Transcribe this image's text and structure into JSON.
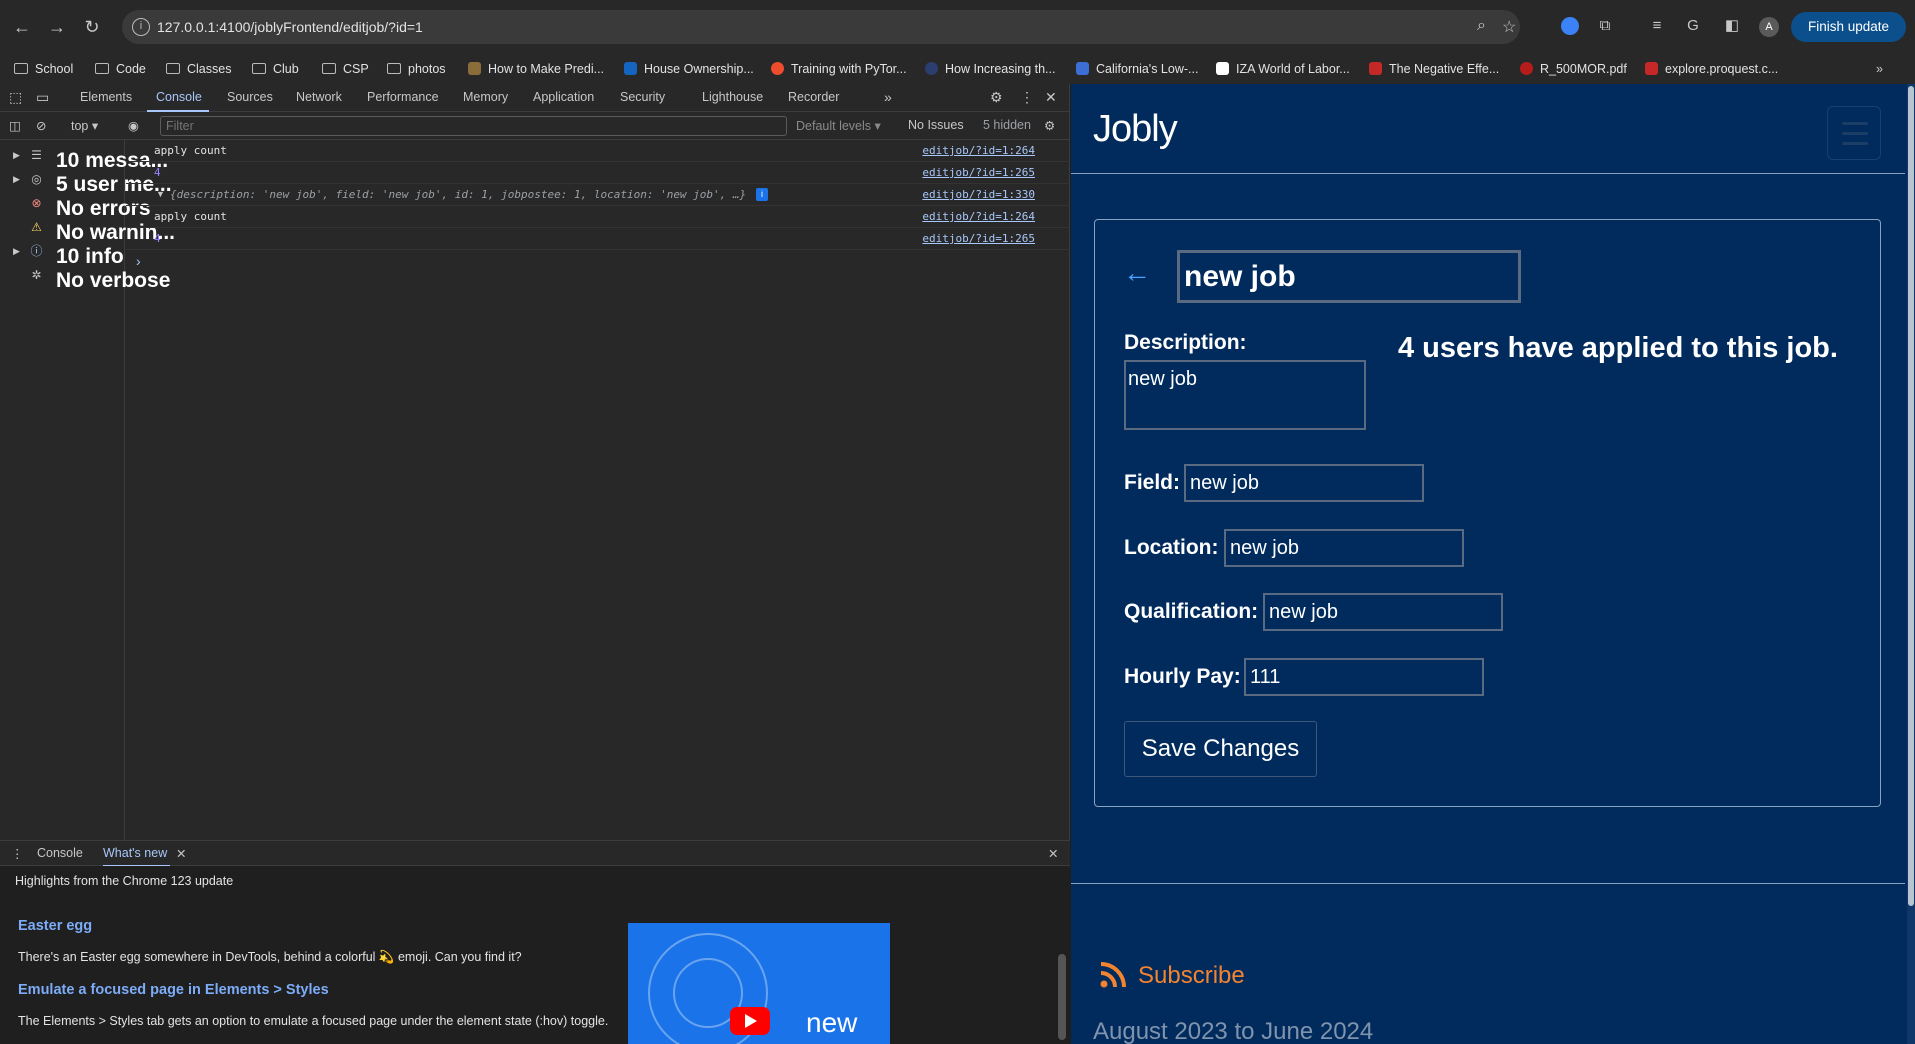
{
  "browser": {
    "url": "127.0.0.1:4100/joblyFrontend/editjob/?id=1",
    "avatar_letter": "A",
    "finish_update": "Finish update",
    "bookmarks": [
      {
        "label": "School",
        "type": "folder"
      },
      {
        "label": "Code",
        "type": "folder"
      },
      {
        "label": "Classes",
        "type": "folder"
      },
      {
        "label": "Club",
        "type": "folder"
      },
      {
        "label": "CSP",
        "type": "folder"
      },
      {
        "label": "photos",
        "type": "folder"
      },
      {
        "label": "How to Make Predi...",
        "type": "page"
      },
      {
        "label": "House Ownership...",
        "type": "page"
      },
      {
        "label": "Training with PyTor...",
        "type": "page"
      },
      {
        "label": "How Increasing th...",
        "type": "page"
      },
      {
        "label": "California's Low-...",
        "type": "page"
      },
      {
        "label": "IZA World of Labor...",
        "type": "page"
      },
      {
        "label": "The Negative Effe...",
        "type": "page"
      },
      {
        "label": "R_500MOR.pdf",
        "type": "page"
      },
      {
        "label": "explore.proquest.c...",
        "type": "page"
      }
    ]
  },
  "devtools": {
    "tabs": [
      "Elements",
      "Console",
      "Sources",
      "Network",
      "Performance",
      "Memory",
      "Application",
      "Security",
      "Lighthouse",
      "Recorder"
    ],
    "active_tab": "Console",
    "context": "top",
    "filter_placeholder": "Filter",
    "default_levels": "Default levels",
    "issues": "No Issues",
    "hidden": "5 hidden",
    "sidebar": [
      {
        "label": "10 messa...",
        "icon": "list-icon",
        "expandable": true
      },
      {
        "label": "5 user me...",
        "icon": "user-icon",
        "expandable": true
      },
      {
        "label": "No errors",
        "icon": "error-icon",
        "expandable": false
      },
      {
        "label": "No warnin...",
        "icon": "warning-icon",
        "expandable": false
      },
      {
        "label": "10 info",
        "icon": "info-icon",
        "expandable": true
      },
      {
        "label": "No verbose",
        "icon": "bug-icon",
        "expandable": false
      }
    ],
    "logs": [
      {
        "text": "apply count",
        "source": "editjob/?id=1:264"
      },
      {
        "text": "4",
        "source": "editjob/?id=1:265"
      },
      {
        "text": "{description: 'new job', field: 'new job', id: 1, jobpostee: 1, location: 'new job', …}",
        "source": "editjob/?id=1:330"
      },
      {
        "text": "apply count",
        "source": "editjob/?id=1:264"
      },
      {
        "text": "4",
        "source": "editjob/?id=1:265"
      }
    ],
    "drawer": {
      "tabs": [
        "Console",
        "What's new"
      ],
      "highlights": "Highlights from the Chrome 123 update",
      "items": [
        {
          "title": "Easter egg",
          "body": "There's an Easter egg somewhere in DevTools, behind a colorful 💫 emoji. Can you find it?"
        },
        {
          "title": "Emulate a focused page in Elements > Styles",
          "body": "The Elements > Styles tab gets an option to emulate a focused page under the element state (:hov) toggle."
        }
      ],
      "video_text": "new"
    }
  },
  "page": {
    "brand": "Jobly",
    "job_title": "new job",
    "description_label": "Description:",
    "description_value": "new job",
    "applied_text": "4 users have applied to this job.",
    "field_label": "Field:",
    "field_value": "new job",
    "location_label": "Location:",
    "location_value": "new job",
    "qualification_label": "Qualification:",
    "qualification_value": "new job",
    "pay_label": "Hourly Pay:",
    "pay_value": "111",
    "save_label": "Save Changes",
    "subscribe_label": "Subscribe",
    "dates": "August 2023 to June 2024"
  },
  "colors": {
    "page_bg": "#002b5c",
    "subscribe": "#f28330",
    "accent": "#a8c7fa"
  }
}
